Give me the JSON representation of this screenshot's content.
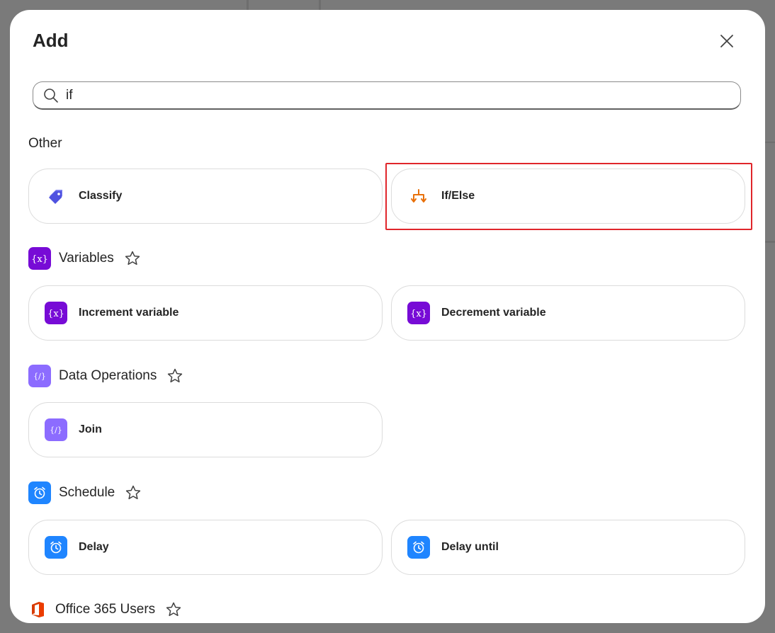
{
  "dialog": {
    "title": "Add"
  },
  "search": {
    "value": "if",
    "placeholder": "Search"
  },
  "sections": {
    "other": {
      "label": "Other",
      "items": [
        {
          "label": "Classify",
          "icon": "tag-icon"
        },
        {
          "label": "If/Else",
          "icon": "branch-icon"
        }
      ]
    },
    "variables": {
      "label": "Variables",
      "icon": "variable-icon",
      "items": [
        {
          "label": "Increment variable",
          "icon": "variable-icon"
        },
        {
          "label": "Decrement variable",
          "icon": "variable-icon"
        }
      ]
    },
    "data_operations": {
      "label": "Data Operations",
      "icon": "data-operations-icon",
      "items": [
        {
          "label": "Join",
          "icon": "data-operations-icon"
        }
      ]
    },
    "schedule": {
      "label": "Schedule",
      "icon": "alarm-clock-icon",
      "items": [
        {
          "label": "Delay",
          "icon": "alarm-clock-icon"
        },
        {
          "label": "Delay until",
          "icon": "alarm-clock-icon"
        }
      ]
    },
    "office365": {
      "label": "Office 365 Users",
      "icon": "office-logo-icon"
    }
  },
  "colors": {
    "variables": "#770bd6",
    "data_operations": "#8c6cff",
    "schedule": "#1f85ff",
    "if_else_icon": "#e8700a",
    "classify_icon": "#4f52e0",
    "highlight": "#e0262b"
  }
}
